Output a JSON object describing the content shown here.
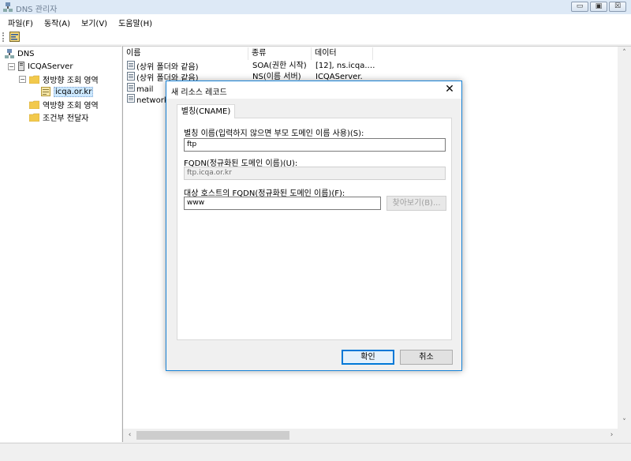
{
  "window": {
    "title": "DNS 관리자",
    "controls": {
      "minimize": "▭",
      "maximize": "▣",
      "close": "☒"
    }
  },
  "menu": [
    "파일(F)",
    "동작(A)",
    "보기(V)",
    "도움말(H)"
  ],
  "tree": {
    "root": "DNS",
    "server": "ICQAServer",
    "forward_zones": "정방향 조회 영역",
    "zone": "icqa.or.kr",
    "reverse_zones": "역방향 조회 영역",
    "conditional_forwarders": "조건부 전달자"
  },
  "list": {
    "columns": [
      "이름",
      "종류",
      "데이터"
    ],
    "rows": [
      {
        "name": "(상위 폴더와 같음)",
        "type": "SOA(권한 시작)",
        "data": "[12], ns.icqa.…"
      },
      {
        "name": "(상위 폴더와 같음)",
        "type": "NS(이름 서버)",
        "data": "ICQAServer."
      },
      {
        "name": "mail",
        "type": "",
        "data": ""
      },
      {
        "name": "network",
        "type": "",
        "data": ""
      }
    ]
  },
  "scroll": {
    "up": "˄",
    "down": "˅",
    "left": "‹",
    "right": "›"
  },
  "dialog": {
    "title": "새 리소스 레코드",
    "close": "✕",
    "tab": "별칭(CNAME)",
    "alias_label": "별칭 이름(입력하지 않으면 부모 도메인 이름 사용)(S):",
    "alias_value": "ftp",
    "fqdn_label": "FQDN(정규화된 도메인 이름)(U):",
    "fqdn_value": "ftp.icqa.or.kr",
    "target_label": "대상 호스트의 FQDN(정규화된 도메인 이름)(F):",
    "target_value": "www",
    "browse_button": "찾아보기(B)...",
    "ok_button": "확인",
    "cancel_button": "취소"
  }
}
